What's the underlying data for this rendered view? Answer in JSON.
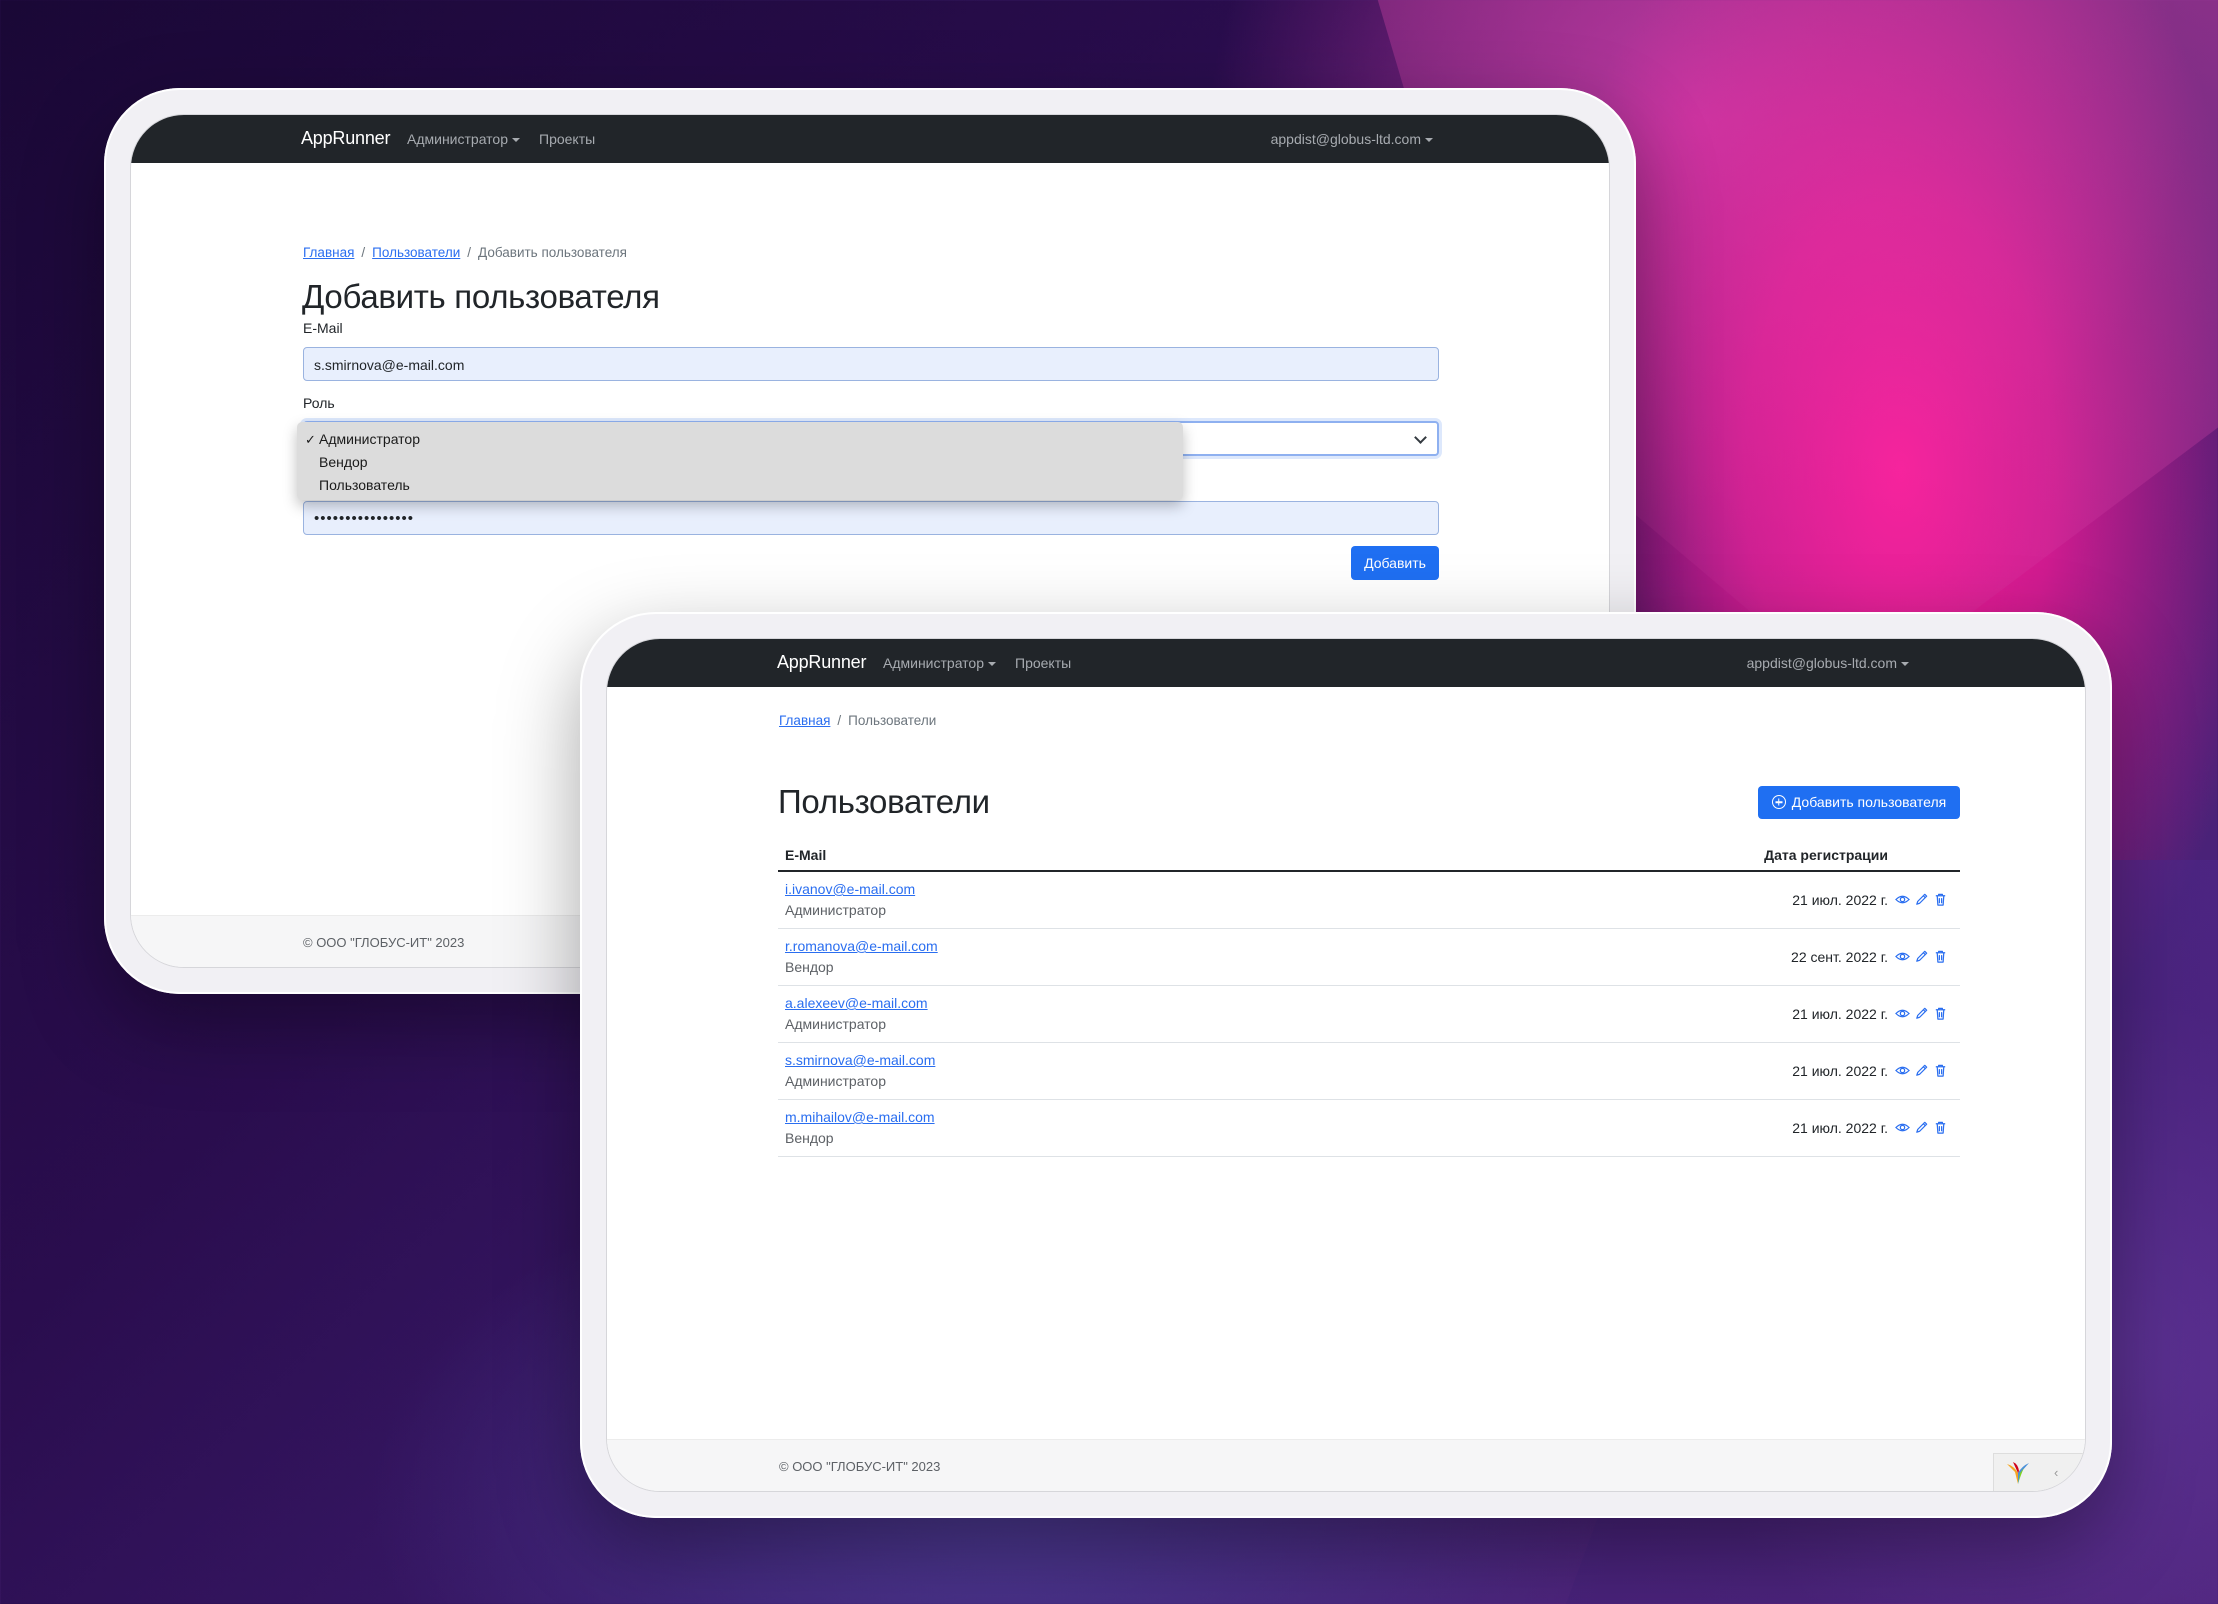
{
  "navbar": {
    "brand": "AppRunner",
    "admin_menu": "Администратор",
    "projects": "Проекты",
    "user_menu": "appdist@globus-ltd.com"
  },
  "add_user_page": {
    "breadcrumb": {
      "home": "Главная",
      "users": "Пользователи",
      "current": "Добавить пользователя"
    },
    "title": "Добавить пользователя",
    "email_label": "E-Mail",
    "email_value": "s.smirnova@e-mail.com",
    "role_label": "Роль",
    "role_options": [
      {
        "label": "Администратор",
        "selected": true
      },
      {
        "label": "Вендор",
        "selected": false
      },
      {
        "label": "Пользователь",
        "selected": false
      }
    ],
    "password_value": "••••••••••••••••",
    "submit_label": "Добавить",
    "footer": "© ООО \"ГЛОБУС-ИТ\" 2023"
  },
  "users_page": {
    "breadcrumb": {
      "home": "Главная",
      "current": "Пользователи"
    },
    "title": "Пользователи",
    "add_button": "Добавить пользователя",
    "columns": {
      "email": "E-Mail",
      "date": "Дата регистрации"
    },
    "rows": [
      {
        "email": "i.ivanov@e-mail.com",
        "role": "Администратор",
        "date": "21 июл. 2022 г."
      },
      {
        "email": "r.romanova@e-mail.com",
        "role": "Вендор",
        "date": "22 сент. 2022 г."
      },
      {
        "email": "a.alexeev@e-mail.com",
        "role": "Администратор",
        "date": "21 июл. 2022 г."
      },
      {
        "email": "s.smirnova@e-mail.com",
        "role": "Администратор",
        "date": "21 июл. 2022 г."
      },
      {
        "email": "m.mihailov@e-mail.com",
        "role": "Вендор",
        "date": "21 июл. 2022 г."
      }
    ],
    "footer": "© ООО \"ГЛОБУС-ИТ\" 2023"
  },
  "icons": {
    "view": "eye-icon",
    "edit": "pencil-icon",
    "delete": "trash-icon",
    "add": "plus-circle-icon",
    "debug": "yii-logo-icon"
  },
  "colors": {
    "navbar": "#212529",
    "primary": "#1f6ff2",
    "link": "#2a6ef0"
  }
}
